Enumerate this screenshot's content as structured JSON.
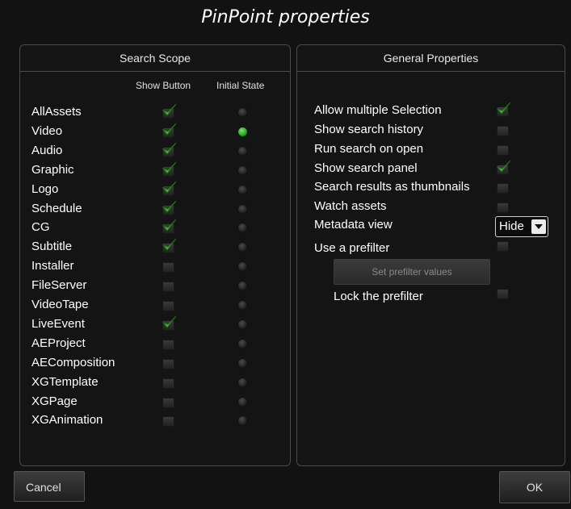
{
  "window": {
    "title": "PinPoint properties"
  },
  "search_scope": {
    "header": "Search Scope",
    "col_show_button": "Show Button",
    "col_initial_state": "Initial State",
    "items": [
      {
        "label": "AllAssets",
        "show": true,
        "initial": false
      },
      {
        "label": "Video",
        "show": true,
        "initial": true
      },
      {
        "label": "Audio",
        "show": true,
        "initial": false
      },
      {
        "label": "Graphic",
        "show": true,
        "initial": false
      },
      {
        "label": "Logo",
        "show": true,
        "initial": false
      },
      {
        "label": "Schedule",
        "show": true,
        "initial": false
      },
      {
        "label": "CG",
        "show": true,
        "initial": false
      },
      {
        "label": "Subtitle",
        "show": true,
        "initial": false
      },
      {
        "label": "Installer",
        "show": false,
        "initial": false
      },
      {
        "label": "FileServer",
        "show": false,
        "initial": false
      },
      {
        "label": "VideoTape",
        "show": false,
        "initial": false
      },
      {
        "label": "LiveEvent",
        "show": true,
        "initial": false
      },
      {
        "label": "AEProject",
        "show": false,
        "initial": false
      },
      {
        "label": "AEComposition",
        "show": false,
        "initial": false
      },
      {
        "label": "XGTemplate",
        "show": false,
        "initial": false
      },
      {
        "label": "XGPage",
        "show": false,
        "initial": false
      },
      {
        "label": "XGAnimation",
        "show": false,
        "initial": false
      }
    ]
  },
  "general": {
    "header": "General Properties",
    "allow_multiple": {
      "label": "Allow multiple Selection",
      "checked": true
    },
    "show_history": {
      "label": "Show search history",
      "checked": false
    },
    "run_on_open": {
      "label": "Run search on open",
      "checked": false
    },
    "show_panel": {
      "label": "Show search panel",
      "checked": true
    },
    "as_thumbnails": {
      "label": "Search results as thumbnails",
      "checked": false
    },
    "watch_assets": {
      "label": "Watch assets",
      "checked": false
    },
    "metadata_view": {
      "label": "Metadata view",
      "value": "Hide"
    },
    "use_prefilter": {
      "label": "Use a prefilter",
      "checked": false
    },
    "set_prefilter_label": "Set prefilter values",
    "lock_prefilter": {
      "label": "Lock the prefilter",
      "checked": false
    }
  },
  "footer": {
    "cancel_label": "Cancel",
    "ok_label": "OK"
  },
  "colors": {
    "check_green": "#3fbf2a",
    "led_on": "#22a51c"
  },
  "icons": {
    "check": "checkmark-icon",
    "led": "status-led-icon",
    "dropdown": "chevron-down-icon"
  }
}
